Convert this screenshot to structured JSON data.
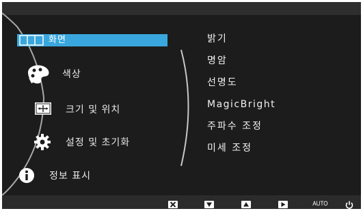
{
  "main_menu": {
    "items": [
      {
        "label": "화면",
        "icon": "picture-icon",
        "selected": true
      },
      {
        "label": "색상",
        "icon": "palette-icon",
        "selected": false
      },
      {
        "label": "크기 및 위치",
        "icon": "move-icon",
        "selected": false
      },
      {
        "label": "설정 및 초기화",
        "icon": "gear-icon",
        "selected": false
      },
      {
        "label": "정보 표시",
        "icon": "info-icon",
        "selected": false
      }
    ]
  },
  "sub_menu": {
    "items": [
      {
        "label": "밝기"
      },
      {
        "label": "명암"
      },
      {
        "label": "선명도"
      },
      {
        "label": "MagicBright"
      },
      {
        "label": "주파수 조정"
      },
      {
        "label": "미세 조정"
      }
    ]
  },
  "controls": {
    "buttons": [
      {
        "icon": "close-icon"
      },
      {
        "icon": "arrow-down-icon"
      },
      {
        "icon": "arrow-up-icon"
      },
      {
        "icon": "arrow-right-icon"
      },
      {
        "label": "AUTO"
      },
      {
        "icon": "power-icon"
      }
    ]
  },
  "colors": {
    "accent": "#39a7dd",
    "background": "#1c1c1c",
    "text": "#e8e8e8"
  }
}
